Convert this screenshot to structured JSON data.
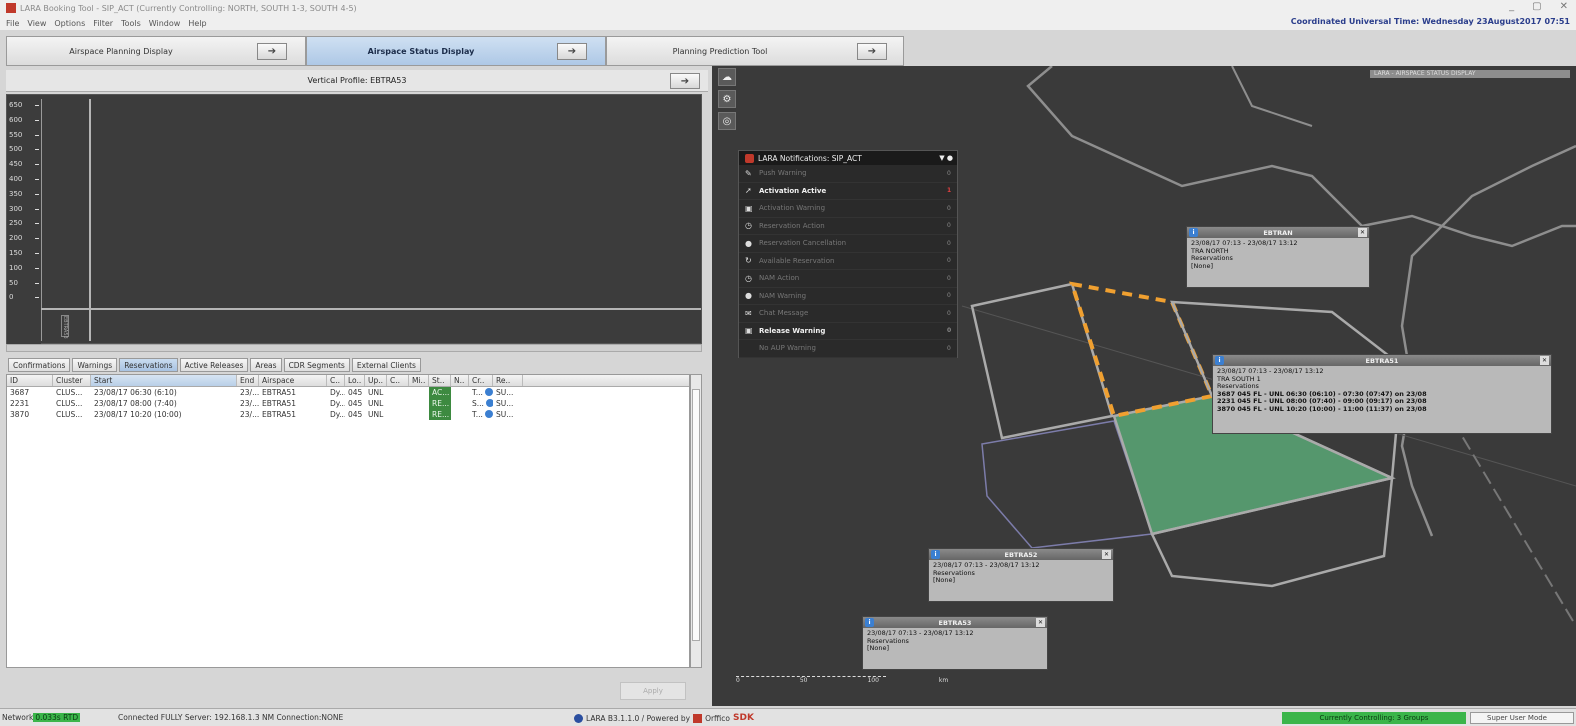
{
  "window": {
    "title": "LARA Booking Tool - SIP_ACT (Currently Controlling: NORTH, SOUTH 1-3, SOUTH 4-5)",
    "controls": [
      "_",
      "▢",
      "✕"
    ]
  },
  "menu": {
    "items": [
      "File",
      "View",
      "Options",
      "Filter",
      "Tools",
      "Window",
      "Help"
    ],
    "utc": "Coordinated Universal Time: Wednesday 23August2017  07:51"
  },
  "top_tabs": [
    {
      "label": "Airspace Planning Display",
      "arrow": "➔"
    },
    {
      "label": "Airspace Status Display",
      "arrow": "➔"
    },
    {
      "label": "Planning Prediction Tool",
      "arrow": "➔"
    }
  ],
  "vertical_profile": {
    "title": "Vertical Profile: EBTRA53",
    "arrow": "➔",
    "y_ticks": [
      "650",
      "600",
      "550",
      "500",
      "450",
      "400",
      "350",
      "300",
      "250",
      "200",
      "150",
      "100",
      "50",
      "0"
    ],
    "bar_label": "EBTRA53"
  },
  "sub_tabs": [
    "Confirmations",
    "Warnings",
    "Reservations",
    "Active Releases",
    "Areas",
    "CDR Segments",
    "External Clients"
  ],
  "table": {
    "columns": [
      "ID",
      "Cluster",
      "Start",
      "End",
      "Airspace",
      "C..",
      "Lo..",
      "Up..",
      "C..",
      "Mi..",
      "St..",
      "N..",
      "Cr..",
      "Re.."
    ],
    "rows": [
      {
        "id": "3687",
        "cluster": "CLUS...",
        "start": "23/08/17 06:30 (6:10)",
        "end": "23/...",
        "airspace": "EBTRA51",
        "c": "Dy...",
        "lo": "045",
        "up": "UNL",
        "st": "AC...",
        "cr": "T...",
        "re": "SU..."
      },
      {
        "id": "2231",
        "cluster": "CLUS...",
        "start": "23/08/17 08:00 (7:40)",
        "end": "23/...",
        "airspace": "EBTRA51",
        "c": "Dy...",
        "lo": "045",
        "up": "UNL",
        "st": "RE...",
        "cr": "S...",
        "re": "SU..."
      },
      {
        "id": "3870",
        "cluster": "CLUS...",
        "start": "23/08/17 10:20 (10:00)",
        "end": "23/...",
        "airspace": "EBTRA51",
        "c": "Dy...",
        "lo": "045",
        "up": "UNL",
        "st": "RE...",
        "cr": "T...",
        "re": "SU..."
      }
    ]
  },
  "table_bottom_button": "Apply",
  "notifications": {
    "title": "LARA Notifications: SIP_ACT",
    "items": [
      {
        "label": "Push Warning",
        "icon": "wrench-icon",
        "glyph": "✎",
        "active": false,
        "count": "0"
      },
      {
        "label": "Activation Active",
        "icon": "plane-icon",
        "glyph": "➚",
        "active": true,
        "count": "1"
      },
      {
        "label": "Activation Warning",
        "icon": "calendar-icon",
        "glyph": "▣",
        "active": false,
        "count": "0"
      },
      {
        "label": "Reservation Action",
        "icon": "clock-icon",
        "glyph": "◷",
        "active": false,
        "count": "0"
      },
      {
        "label": "Reservation Cancellation",
        "icon": "circle-icon",
        "glyph": "●",
        "active": false,
        "count": "0"
      },
      {
        "label": "Available Reservation",
        "icon": "refresh-icon",
        "glyph": "↻",
        "active": false,
        "count": "0"
      },
      {
        "label": "NAM Action",
        "icon": "clock-icon",
        "glyph": "◷",
        "active": false,
        "count": "0"
      },
      {
        "label": "NAM Warning",
        "icon": "circle-icon",
        "glyph": "●",
        "active": false,
        "count": "0"
      },
      {
        "label": "Chat Message",
        "icon": "chat-icon",
        "glyph": "✉",
        "active": false,
        "count": "0"
      },
      {
        "label": "Release Warning",
        "icon": "calendar-icon",
        "glyph": "▣",
        "active": true,
        "count": "0"
      },
      {
        "label": "No AUP Warning",
        "icon": "none-icon",
        "glyph": " ",
        "active": false,
        "count": "0"
      }
    ]
  },
  "infoboxes": {
    "north": {
      "title": "EBTRAN",
      "lines": [
        "23/08/17 07:13 - 23/08/17 13:12",
        "TRA NORTH",
        "Reservations",
        "[None]"
      ]
    },
    "a51": {
      "title": "EBTRA51",
      "lines": [
        "23/08/17 07:13 - 23/08/17 13:12",
        "TRA SOUTH 1",
        "Reservations"
      ],
      "reservations": [
        "3687 045 FL - UNL 06:30 (06:10) - 07:30 (07:47) on 23/08",
        "2231 045 FL - UNL 08:00 (07:40) - 09:00 (09:17) on 23/08",
        "3870 045 FL - UNL 10:20 (10:00) - 11:00 (11:37) on 23/08"
      ]
    },
    "a52": {
      "title": "EBTRA52",
      "lines": [
        "23/08/17 07:13 - 23/08/17 13:12",
        "Reservations",
        "[None]"
      ]
    },
    "a53": {
      "title": "EBTRA53",
      "lines": [
        "23/08/17 07:13 - 23/08/17 13:12",
        "Reservations",
        "[None]"
      ]
    }
  },
  "map": {
    "top_right_label": "LARA - AIRSPACE STATUS DISPLAY",
    "scale_labels": [
      "0",
      "50",
      "100"
    ],
    "scale_unit": "km"
  },
  "statusbar": {
    "net_label": "Network",
    "rtd": "0.033s RTD",
    "connection": "Connected FULLY Server: 192.168.1.3 NM Connection:NONE",
    "version": "LARA B3.1.1.0  /  Powered by",
    "vendor": "Orffico",
    "sdk": "SDK",
    "controlling": "Currently Controlling: 3 Groups",
    "user": "Super User Mode"
  },
  "colors": {
    "accent": "#3bb54a",
    "active_tab": "#aec8e6",
    "area_highlight": "#5aa877",
    "dashed_orange": "#f0a030"
  }
}
